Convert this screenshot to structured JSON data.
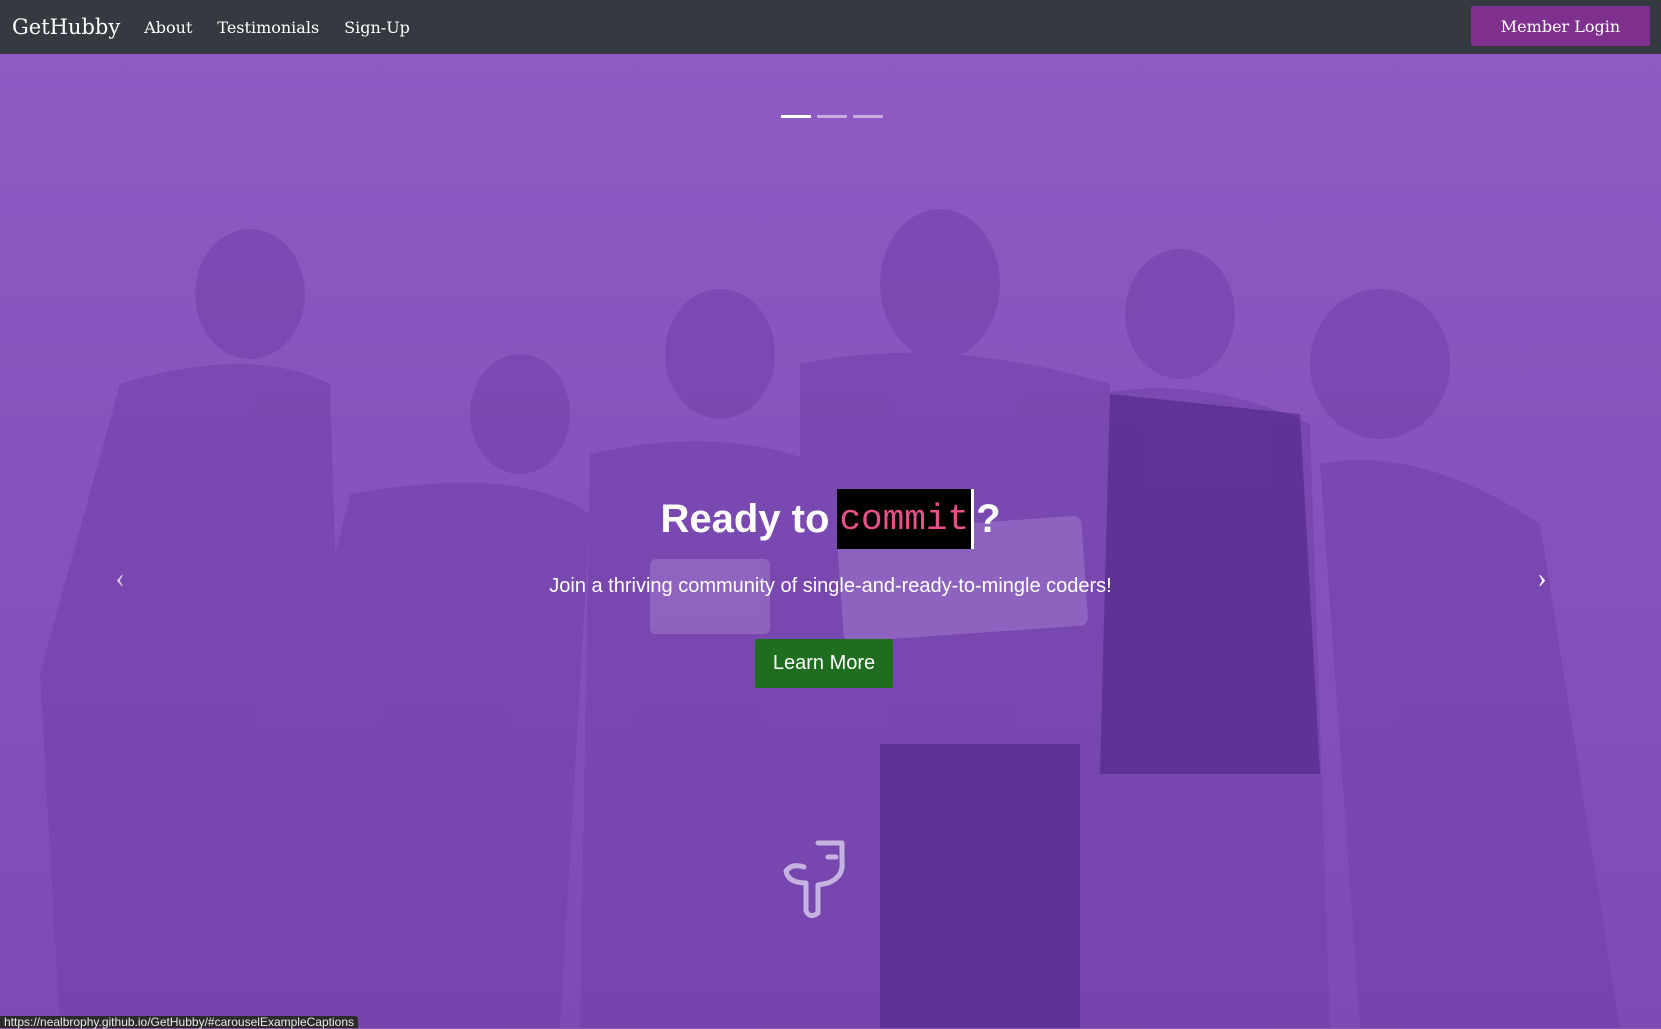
{
  "navbar": {
    "brand": "GetHubby",
    "links": [
      "About",
      "Testimonials",
      "Sign-Up"
    ],
    "login_label": "Member Login"
  },
  "hero": {
    "headline_prefix": "Ready to",
    "headline_code": "commit",
    "headline_suffix": "?",
    "subtitle": "Join a thriving community of single-and-ready-to-mingle coders!",
    "cta_label": "Learn More",
    "prev_glyph": "‹",
    "next_glyph": "›"
  },
  "status_url": "https://nealbrophy.github.io/GetHubby/#carouselExampleCaptions",
  "colors": {
    "navbar_bg": "#343a40",
    "login_bg": "#7f2f8e",
    "hero_overlay": "#8a57bd",
    "cta_bg": "#1f6d1f",
    "code_text": "#e8508a"
  },
  "carousel": {
    "slide_count": 3,
    "active_index": 0
  }
}
